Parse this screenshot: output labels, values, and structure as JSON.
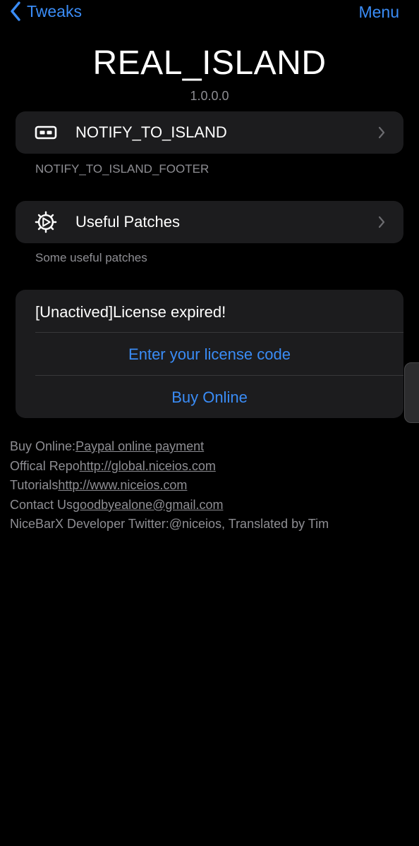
{
  "nav": {
    "back_label": "Tweaks",
    "menu_label": "Menu"
  },
  "header": {
    "title": "REAL_ISLAND",
    "version": "1.0.0.0"
  },
  "sections": [
    {
      "label": "NOTIFY_TO_ISLAND",
      "icon": "pill-icon",
      "footer": "NOTIFY_TO_ISLAND_FOOTER"
    },
    {
      "label": "Useful Patches",
      "icon": "gear-icon",
      "footer": "Some useful patches"
    }
  ],
  "license": {
    "status": "[Unactived]License expired!",
    "enter_code_label": "Enter your license code",
    "buy_online_label": "Buy Online"
  },
  "links": [
    {
      "prefix": "Buy Online:",
      "link": "Paypal online payment"
    },
    {
      "prefix": "Offical Repo",
      "link": "http://global.niceios.com"
    },
    {
      "prefix": "Tutorials",
      "link": "http://www.niceios.com"
    },
    {
      "prefix": "Contact Us",
      "link": "goodbyealone@gmail.com"
    },
    {
      "prefix": "NiceBarX Developer Twitter:@niceios, Translated by Tim",
      "link": ""
    }
  ],
  "colors": {
    "accent": "#3a8cf6",
    "cell_bg": "#1c1c1e",
    "secondary_text": "#8e8e93"
  }
}
